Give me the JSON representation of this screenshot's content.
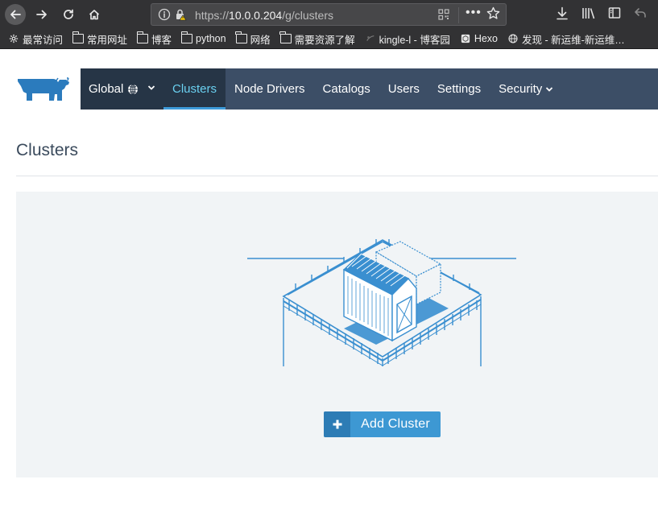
{
  "browser": {
    "url_prefix": "https://",
    "url_host": "10.0.0.204",
    "url_path": "/g/clusters",
    "bookmarks": [
      {
        "label": "最常访问",
        "icon": "gear-icon"
      },
      {
        "label": "常用网址",
        "icon": "folder-icon"
      },
      {
        "label": "博客",
        "icon": "folder-icon"
      },
      {
        "label": "python",
        "icon": "folder-icon"
      },
      {
        "label": "网络",
        "icon": "folder-icon"
      },
      {
        "label": "需要资源了解",
        "icon": "folder-icon"
      },
      {
        "label": "kingle-l - 博客园",
        "icon": "site-icon"
      },
      {
        "label": "Hexo",
        "icon": "hexo-icon"
      },
      {
        "label": "发现 - 新运维-新运维…",
        "icon": "globe-icon"
      }
    ]
  },
  "nav": {
    "global_label": "Global",
    "tabs": [
      {
        "label": "Clusters",
        "active": true
      },
      {
        "label": "Node Drivers",
        "active": false
      },
      {
        "label": "Catalogs",
        "active": false
      },
      {
        "label": "Users",
        "active": false
      },
      {
        "label": "Settings",
        "active": false
      },
      {
        "label": "Security",
        "active": false
      }
    ]
  },
  "page": {
    "title": "Clusters",
    "add_button_label": "Add Cluster",
    "add_button_icon": "plus-icon"
  },
  "colors": {
    "nav_bg": "#3c4e66",
    "nav_active_bg": "#263546",
    "accent": "#3d98d3",
    "illustration": "#3a8fd0"
  }
}
